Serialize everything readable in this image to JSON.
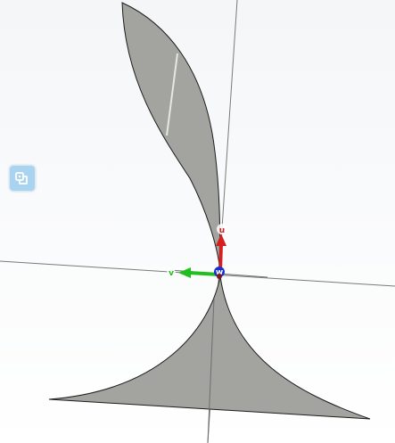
{
  "viewport": {
    "background_top": "#f4f6f8",
    "background_bottom": "#ffffff",
    "grid_line_color": "#7a7a7a",
    "surface_fill": "#a3a3a0",
    "surface_stroke": "#1c1c1c",
    "highlight_color": "#e6e6e3"
  },
  "triad": {
    "u_label": "u",
    "v_label": "v",
    "w_label": "w",
    "u_color": "#d42020",
    "v_color": "#1fbf1f",
    "w_color": "#1a2fd6",
    "origin_color": "#7a1a1a"
  },
  "side_widget": {
    "icon": "view-cube-icon",
    "color": "#a9d3ef"
  }
}
